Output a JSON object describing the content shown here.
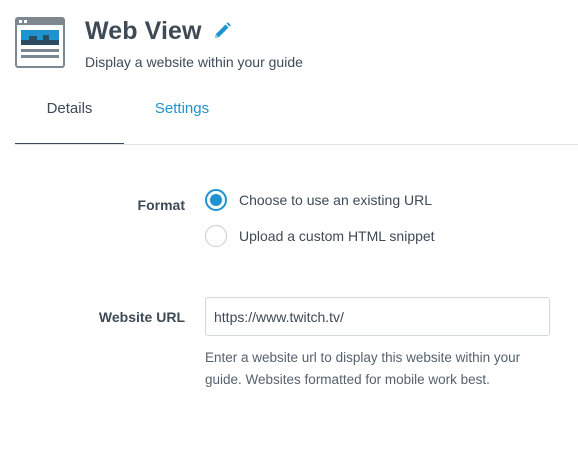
{
  "header": {
    "icon": "web-view-icon",
    "title": "Web View",
    "edit_icon": "pencil-icon",
    "subtitle": "Display a website within your guide"
  },
  "tabs": [
    {
      "label": "Details",
      "active": true
    },
    {
      "label": "Settings",
      "active": false
    }
  ],
  "form": {
    "format": {
      "label": "Format",
      "options": [
        {
          "label": "Choose to use an existing URL",
          "checked": true
        },
        {
          "label": "Upload a custom HTML snippet",
          "checked": false
        }
      ]
    },
    "website_url": {
      "label": "Website URL",
      "value": "https://www.twitch.tv/",
      "help": "Enter a website url to display this website within your guide. Websites formatted for mobile work best."
    }
  },
  "colors": {
    "accent": "#1f93cf",
    "text": "#3e4a56",
    "divider": "#dfe3e6"
  }
}
